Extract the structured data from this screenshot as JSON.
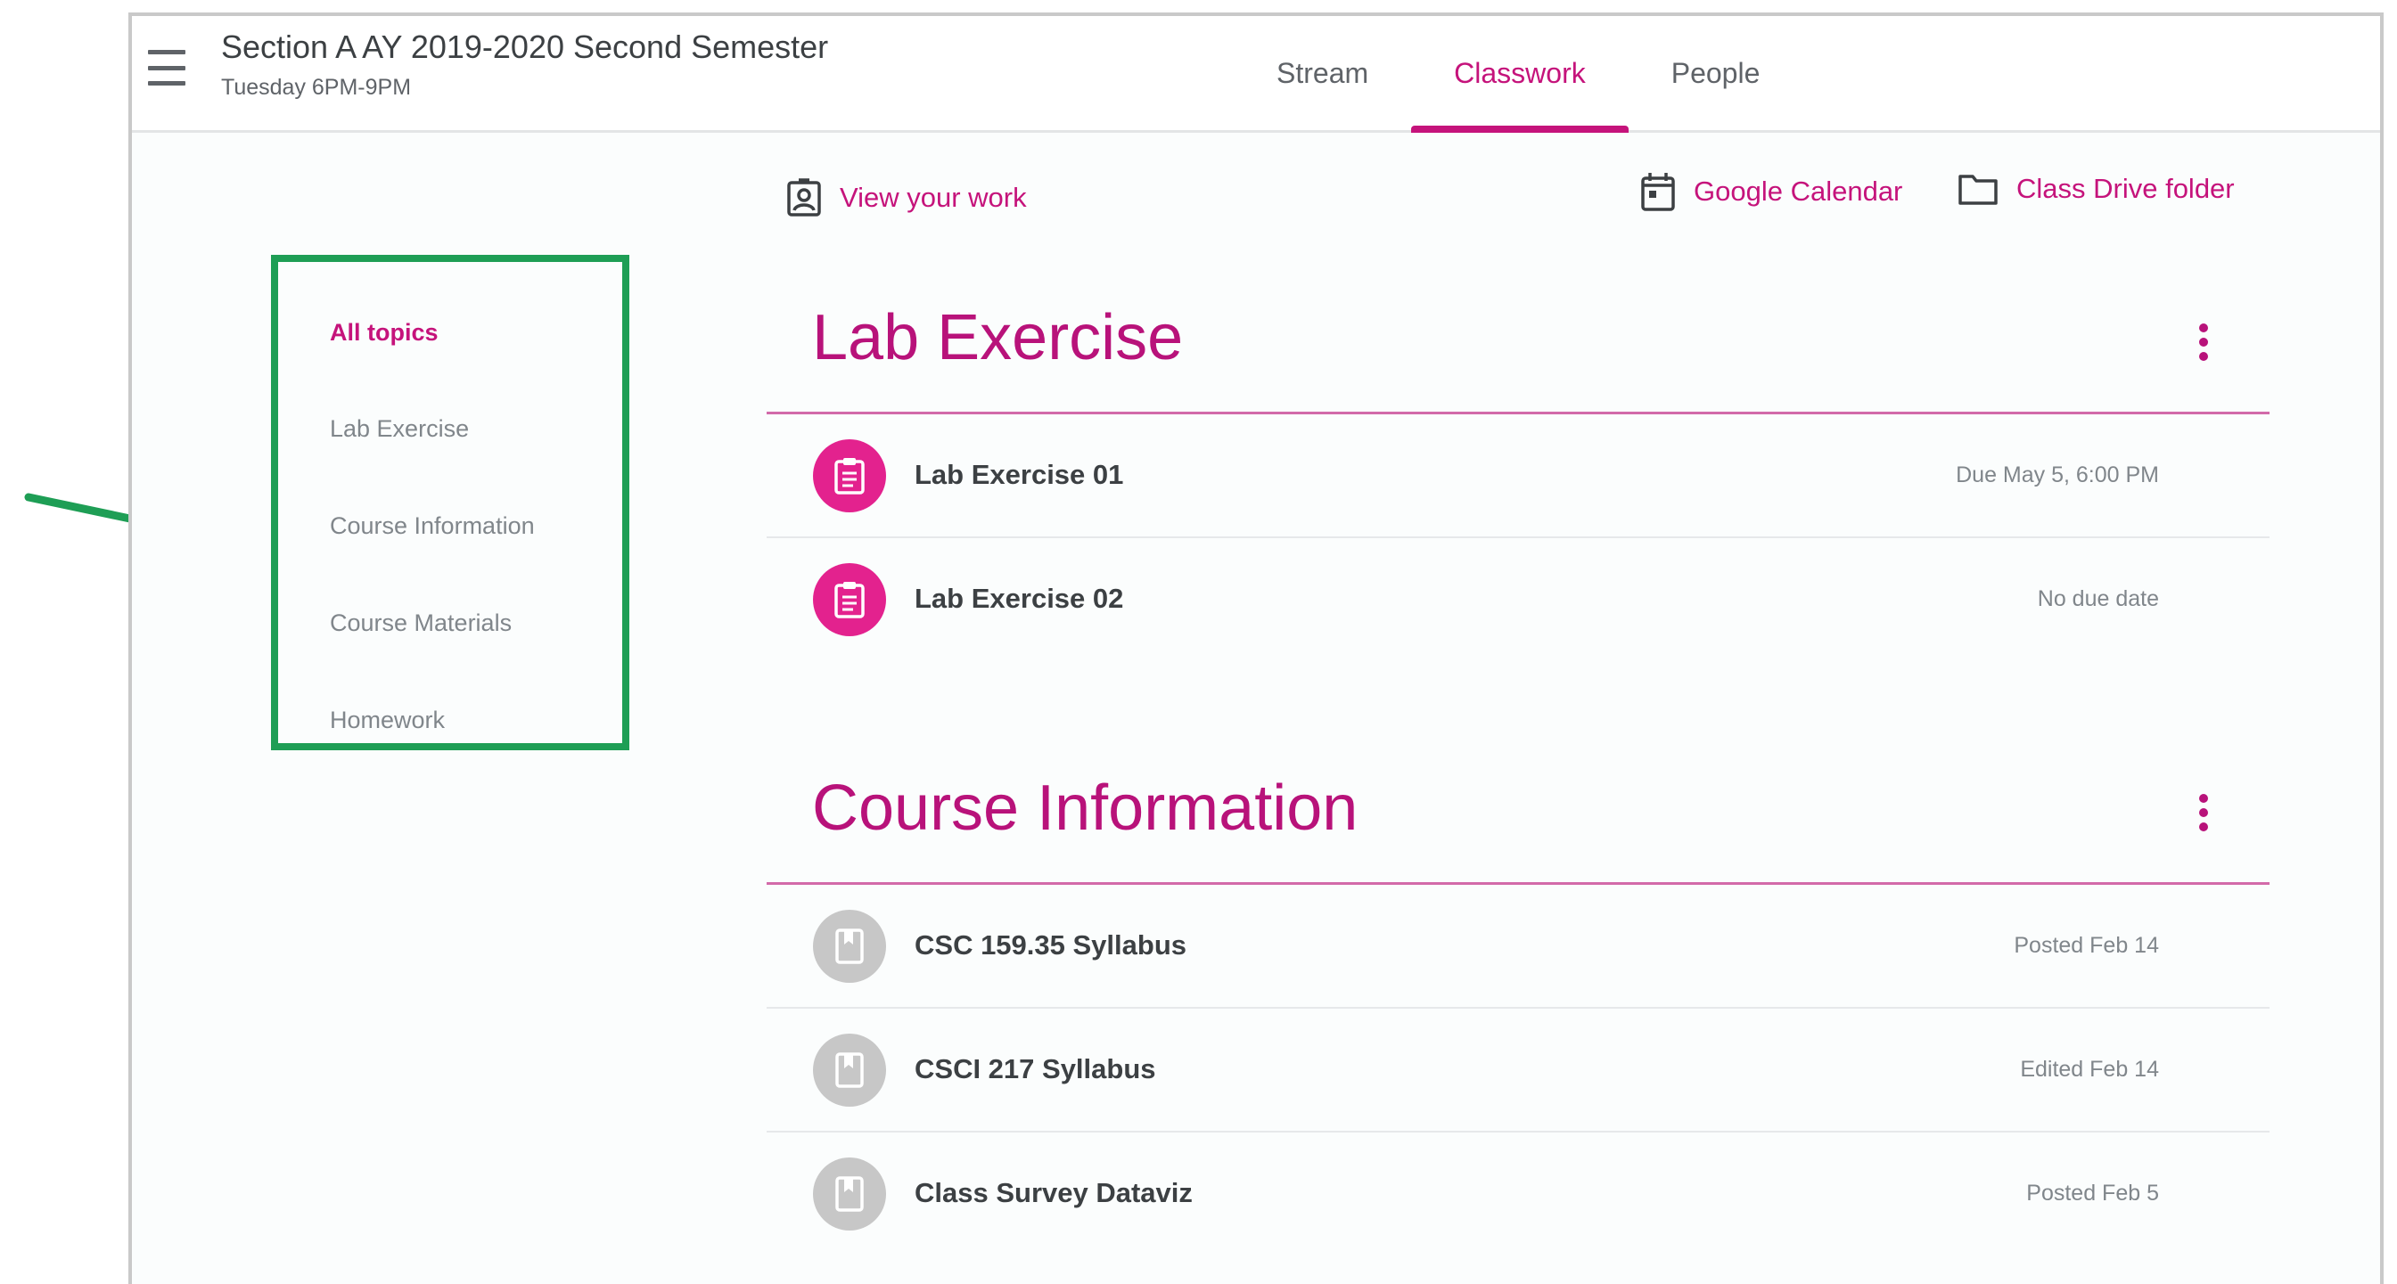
{
  "header": {
    "class_title": "Section A AY 2019-2020 Second Semester",
    "class_subtitle": "Tuesday 6PM-9PM",
    "tabs": [
      {
        "label": "Stream"
      },
      {
        "label": "Classwork"
      },
      {
        "label": "People"
      }
    ],
    "active_tab": "Classwork"
  },
  "toolbar": {
    "view_work_label": "View your work",
    "calendar_label": "Google Calendar",
    "drive_label": "Class Drive folder"
  },
  "topics": {
    "items": [
      {
        "label": "All topics"
      },
      {
        "label": "Lab Exercise"
      },
      {
        "label": "Course Information"
      },
      {
        "label": "Course Materials"
      },
      {
        "label": "Homework"
      }
    ],
    "selected": "All topics"
  },
  "sections": [
    {
      "title": "Lab Exercise",
      "items": [
        {
          "title": "Lab Exercise 01",
          "meta": "Due May 5, 6:00 PM",
          "kind": "assignment"
        },
        {
          "title": "Lab Exercise 02",
          "meta": "No due date",
          "kind": "assignment"
        }
      ]
    },
    {
      "title": "Course Information",
      "items": [
        {
          "title": "CSC 159.35 Syllabus",
          "meta": "Posted Feb 14",
          "kind": "material"
        },
        {
          "title": "CSCI 217 Syllabus",
          "meta": "Edited Feb 14",
          "kind": "material"
        },
        {
          "title": "Class Survey Dataviz",
          "meta": "Posted Feb 5",
          "kind": "material"
        }
      ]
    }
  ],
  "colors": {
    "accent": "#c5137b",
    "assignment_icon_bg": "#e3228e",
    "material_icon_bg": "#c7c7c7",
    "highlight_box": "#1e9e55",
    "annotation_arrow": "#1e9e55"
  }
}
